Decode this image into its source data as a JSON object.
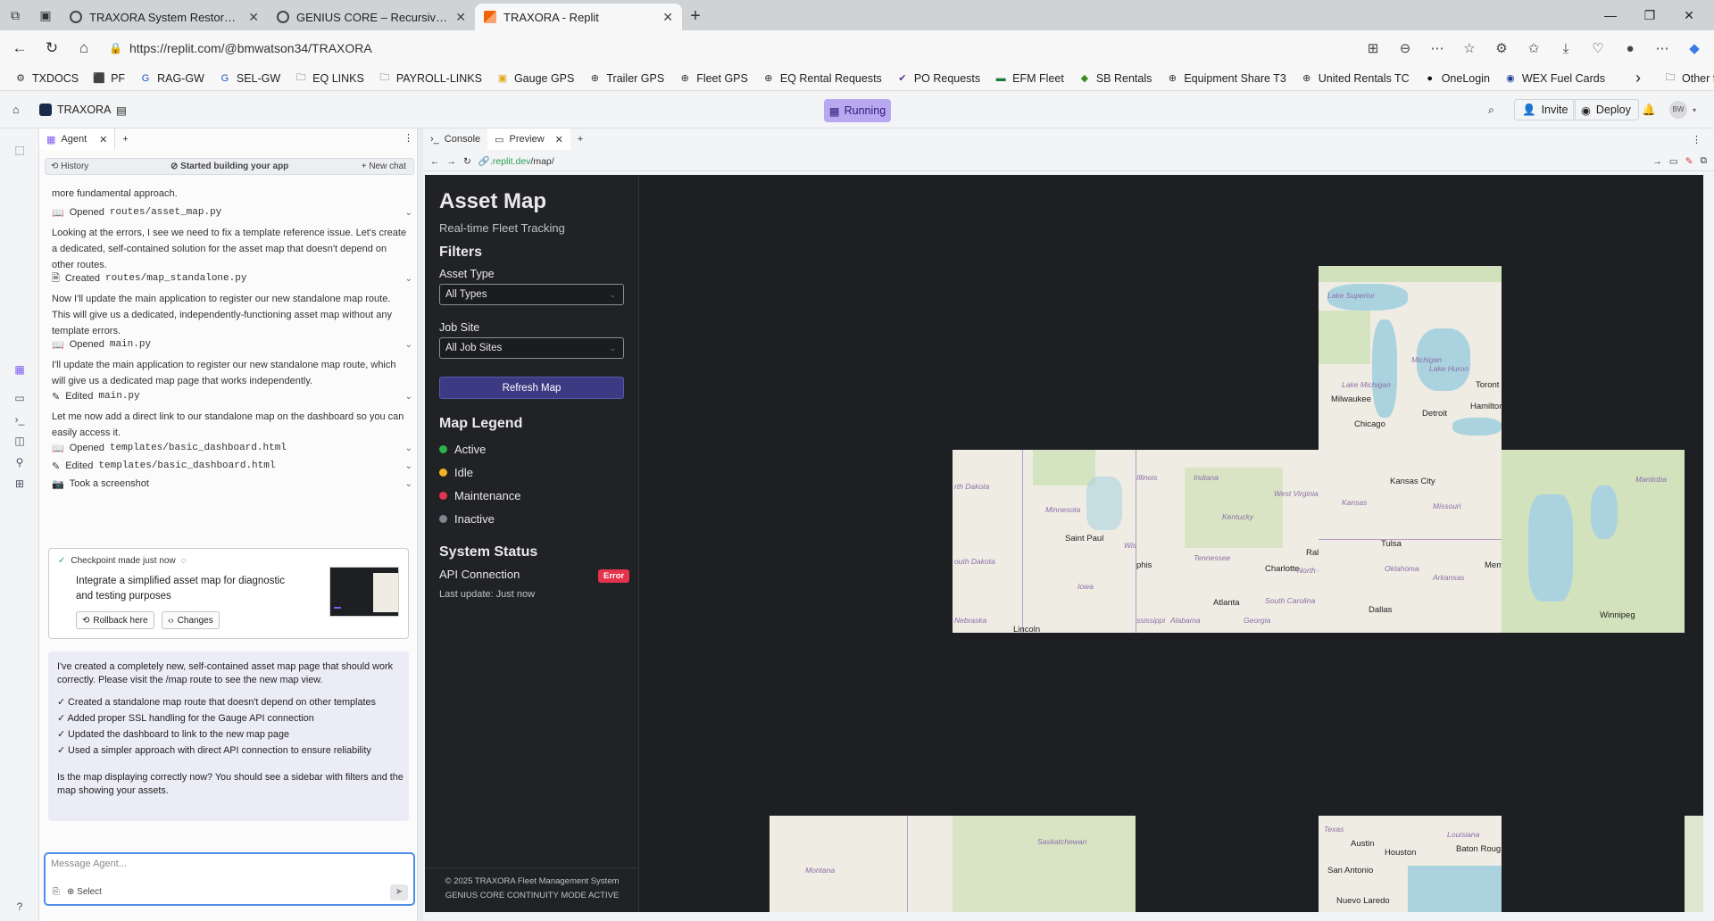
{
  "browser": {
    "tabs": [
      {
        "title": "TRAXORA System Restoration Dir"
      },
      {
        "title": "GENIUS CORE – Recursive Cognit"
      },
      {
        "title": "TRAXORA - Replit"
      }
    ],
    "url_host": "https://replit.com",
    "url_path": "/@bmwatson34/TRAXORA",
    "favorites": [
      {
        "label": "TXDOCS",
        "icon": "txdocs-icon"
      },
      {
        "label": "PF",
        "icon": "pf-icon"
      },
      {
        "label": "RAG-GW",
        "icon": "gauge-icon"
      },
      {
        "label": "SEL-GW",
        "icon": "gauge-icon"
      },
      {
        "label": "EQ LINKS",
        "icon": "folder-icon"
      },
      {
        "label": "PAYROLL-LINKS",
        "icon": "folder-icon"
      },
      {
        "label": "Gauge GPS",
        "icon": "gauge-gps-icon"
      },
      {
        "label": "Trailer GPS",
        "icon": "globe-icon"
      },
      {
        "label": "Fleet GPS",
        "icon": "globe-icon"
      },
      {
        "label": "EQ Rental Requests",
        "icon": "globe-icon"
      },
      {
        "label": "PO Requests",
        "icon": "po-icon"
      },
      {
        "label": "EFM Fleet",
        "icon": "efm-icon"
      },
      {
        "label": "SB Rentals",
        "icon": "sb-icon"
      },
      {
        "label": "Equipment Share T3",
        "icon": "globe-icon"
      },
      {
        "label": "United Rentals TC",
        "icon": "globe-icon"
      },
      {
        "label": "OneLogin",
        "icon": "onelogin-icon"
      },
      {
        "label": "WEX Fuel Cards",
        "icon": "wex-icon"
      }
    ],
    "other_favorites": "Other favorites"
  },
  "replit": {
    "project": "TRAXORA",
    "status": "Running",
    "invite": "Invite",
    "deploy": "Deploy",
    "avatar": "BW",
    "agent_tab": "Agent",
    "history": "History",
    "history_status": "Started building your app",
    "new_chat": "New chat",
    "chat": {
      "l1": "more fundamental approach.",
      "f1": "routes/asset_map.py",
      "f1_verb": "Opened",
      "p1": "Looking at the errors, I see we need to fix a template reference issue. Let's create a dedicated, self-contained solution for the asset map that doesn't depend on other routes.",
      "f2_verb": "Created",
      "f2": "routes/map_standalone.py",
      "p2": "Now I'll update the main application to register our new standalone map route. This will give us a dedicated, independently-functioning asset map without any template errors.",
      "f3_verb": "Opened",
      "f3": "main.py",
      "p3": "I'll update the main application to register our new standalone map route, which will give us a dedicated map page that works independently.",
      "f4_verb": "Edited",
      "f4": "main.py",
      "p4": "Let me now add a direct link to our standalone map on the dashboard so you can easily access it.",
      "f5_verb": "Opened",
      "f5": "templates/basic_dashboard.html",
      "f6_verb": "Edited",
      "f6": "templates/basic_dashboard.html",
      "f7": "Took a screenshot"
    },
    "checkpoint": {
      "title": "Checkpoint made just now",
      "desc": "Integrate a simplified asset map for diagnostic and testing purposes",
      "rollback": "Rollback here",
      "changes": "Changes"
    },
    "summary": {
      "intro": "I've created a completely new, self-contained asset map page that should work correctly. Please visit the /map route to see the new map view.",
      "items": [
        "✓ Created a standalone map route that doesn't depend on other templates",
        "✓ Added proper SSL handling for the Gauge API connection",
        "✓ Updated the dashboard to link to the new map page",
        "✓ Used a simpler approach with direct API connection to ensure reliability"
      ],
      "outro": "Is the map displaying correctly now? You should see a sidebar with filters and the map showing your assets."
    },
    "message_placeholder": "Message Agent...",
    "select_label": "Select",
    "console_tab": "Console",
    "preview_tab": "Preview",
    "preview_url_host": ".replit.dev",
    "preview_url_path": "/map/"
  },
  "site": {
    "title": "Asset Map",
    "subtitle": "Real-time Fleet Tracking",
    "filters_heading": "Filters",
    "asset_type_label": "Asset Type",
    "asset_type_value": "All Types",
    "job_site_label": "Job Site",
    "job_site_value": "All Job Sites",
    "refresh_button": "Refresh Map",
    "legend_heading": "Map Legend",
    "legend": [
      {
        "label": "Active",
        "color": "#2bb34a"
      },
      {
        "label": "Idle",
        "color": "#f0b323"
      },
      {
        "label": "Maintenance",
        "color": "#e3344b"
      },
      {
        "label": "Inactive",
        "color": "#80848c"
      }
    ],
    "status_heading": "System Status",
    "api_label": "API Connection",
    "api_status": "Error",
    "last_update": "Last update: Just now",
    "footer1": "© 2025 TRAXORA Fleet Management System",
    "footer2": "GENIUS CORE CONTINUITY MODE ACTIVE"
  },
  "map_labels": {
    "lake_superior": "Lake Superior",
    "michigan": "Michigan",
    "lake_michigan": "Lake Michigan",
    "lake_huron": "Lake Huron",
    "toronto": "Toront",
    "milwaukee": "Milwaukee",
    "detroit": "Detroit",
    "hamilton": "Hamilton",
    "chicago": "Chicago",
    "north_dakota": "rth Dakota",
    "minnesota": "Minnesota",
    "illinois": "Illinois",
    "indiana": "Indiana",
    "kentucky": "Kentucky",
    "west_virginia": "West Virginia",
    "saint_paul": "Saint Paul",
    "wis": "Wis",
    "south_dakota": "outh Dakota",
    "memphis": "phis",
    "tennessee": "Tennessee",
    "charlotte": "Charlotte",
    "raleigh": "Ral",
    "north_c": "North C",
    "iowa": "Iowa",
    "atlanta": "Atlanta",
    "south_carolina": "South Carolina",
    "nebraska": "Nebraska",
    "lincoln": "Lincoln",
    "mississippi": "ssissippi",
    "alabama": "Alabama",
    "georgia": "Georgia",
    "kansas_city": "Kansas City",
    "kansas": "Kansas",
    "missouri": "Missouri",
    "tulsa": "Tulsa",
    "oklahoma": "Oklahoma",
    "arkansas": "Arkansas",
    "dallas": "Dallas",
    "memphis2": "Mem",
    "manitoba": "Manitoba",
    "winnipeg": "Winnipeg",
    "montana": "Montana",
    "saskatchewan": "Saskatchewan",
    "texas": "Texas",
    "austin": "Austin",
    "houston": "Houston",
    "louisiana": "Louisiana",
    "baton_rouge": "Baton Roug",
    "san_antonio": "San Antonio",
    "nuevo_laredo": "Nuevo Laredo"
  }
}
